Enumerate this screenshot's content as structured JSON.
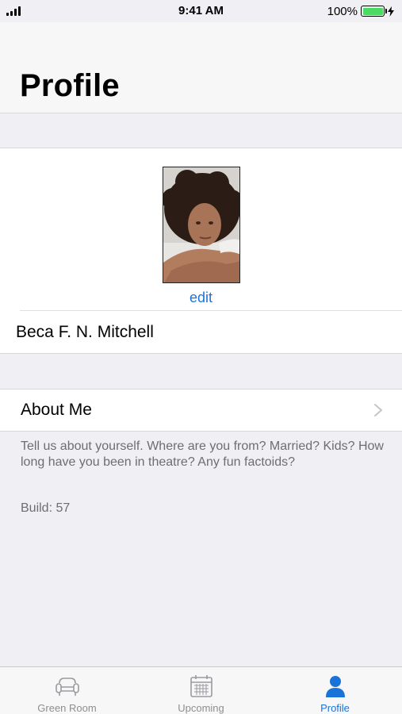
{
  "status_bar": {
    "time": "9:41 AM",
    "battery_percent": "100%",
    "battery_level": 1.0,
    "signal_bars": 4
  },
  "header": {
    "title": "Profile"
  },
  "profile": {
    "avatar_icon": "profile-photo",
    "edit_label": "edit",
    "name": "Beca F. N. Mitchell"
  },
  "about": {
    "label": "About Me",
    "chevron_icon": "chevron-right-icon",
    "hint": "Tell us about yourself. Where are you from? Married? Kids? How long have you been in theatre? Any fun factoids?"
  },
  "build": {
    "label": "Build: 57"
  },
  "tabs": [
    {
      "label": "Green Room",
      "icon": "sofa-icon",
      "active": false
    },
    {
      "label": "Upcoming",
      "icon": "calendar-icon",
      "active": false
    },
    {
      "label": "Profile",
      "icon": "person-icon",
      "active": true
    }
  ],
  "colors": {
    "accent": "#1a73d9",
    "background": "#efeff4",
    "battery": "#4cd964",
    "inactive_tab": "#8e8e93"
  }
}
